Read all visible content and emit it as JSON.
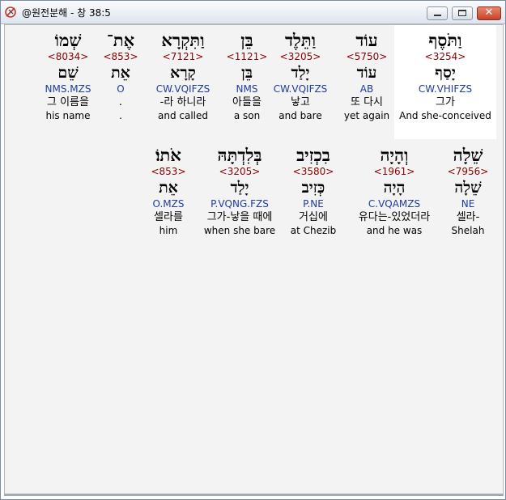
{
  "window": {
    "title": "@원전분해 - 창 38:5",
    "controls": {
      "minimize": "minimize",
      "maximize": "maximize",
      "close": "✕"
    }
  },
  "rows": [
    {
      "words": [
        {
          "hebrew": "וַתֹּסֶף",
          "strong": "<3254>",
          "root": "יָסַף",
          "parse": "CW.VHIFZS",
          "korean": "그가",
          "english": "And she-conceived",
          "selected": true
        },
        {
          "hebrew": "עוֹד",
          "strong": "<5750>",
          "root": "עוֹד",
          "parse": "AB",
          "korean": "또 다시",
          "english": "yet again"
        },
        {
          "hebrew": "וַתֵּלֶד",
          "strong": "<3205>",
          "root": "יָלַד",
          "parse": "CW.VQIFZS",
          "korean": "낳고",
          "english": "and bare"
        },
        {
          "hebrew": "בֵּן",
          "strong": "<1121>",
          "root": "בֵּן",
          "parse": "NMS",
          "korean": "아들을",
          "english": "a son"
        },
        {
          "hebrew": "וַתִּקְרָא",
          "strong": "<7121>",
          "root": "קָרָא",
          "parse": "CW.VQIFZS",
          "korean": "-라 하니라",
          "english": "and called"
        },
        {
          "hebrew": "אֶת־",
          "strong": "<853>",
          "root": "אֵת",
          "parse": "O",
          "korean": ".",
          "english": "."
        },
        {
          "hebrew": "שְׁמוֹ",
          "strong": "<8034>",
          "root": "שֵׁם",
          "parse": "NMS.MZS",
          "korean": "그 이름을",
          "english": "his name"
        }
      ]
    },
    {
      "words": [
        {
          "hebrew": "שֵׁלָה",
          "strong": "<7956>",
          "root": "שֵׁלָה",
          "parse": "NE",
          "korean": "셀라-",
          "english": "Shelah"
        },
        {
          "hebrew": "וְהָיָה",
          "strong": "<1961>",
          "root": "הָיָה",
          "parse": "C.VQAMZS",
          "korean": "유다는-있었더라",
          "english": "and he was"
        },
        {
          "hebrew": "בִכְזִיב",
          "strong": "<3580>",
          "root": "כְּזִיב",
          "parse": "P.NE",
          "korean": "거십에",
          "english": "at Chezib"
        },
        {
          "hebrew": "בְּלִדְתָּהּ",
          "strong": "<3205>",
          "root": "יָלַד",
          "parse": "P.VQNG.FZS",
          "korean": "그가-낳을 때에",
          "english": "when she bare"
        },
        {
          "hebrew": "אֹתוֹ׃",
          "strong": "<853>",
          "root": "אֵת",
          "parse": "O.MZS",
          "korean": "셀라를",
          "english": "him"
        }
      ]
    }
  ]
}
